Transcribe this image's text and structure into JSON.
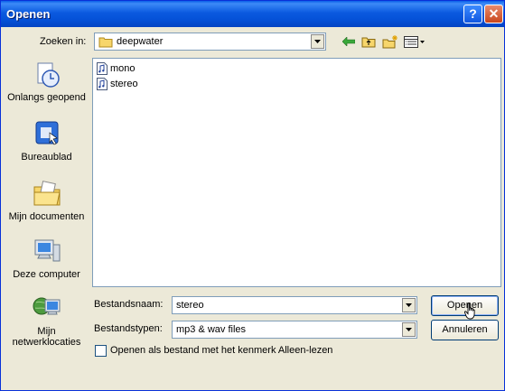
{
  "window": {
    "title": "Openen",
    "help_glyph": "?",
    "close_glyph": "✕"
  },
  "look_in": {
    "label": "Zoeken in:",
    "value": "deepwater"
  },
  "toolbar": {
    "icons": [
      "back-arrow-icon",
      "up-folder-icon",
      "new-folder-icon",
      "view-menu-icon"
    ]
  },
  "places": [
    {
      "label": "Onlangs geopend",
      "icon": "recent-documents-icon"
    },
    {
      "label": "Bureaublad",
      "icon": "desktop-icon"
    },
    {
      "label": "Mijn documenten",
      "icon": "my-documents-icon"
    },
    {
      "label": "Deze computer",
      "icon": "my-computer-icon"
    },
    {
      "label": "Mijn netwerklocaties",
      "icon": "network-places-icon"
    }
  ],
  "files": [
    {
      "name": "mono",
      "icon": "audio-file-icon"
    },
    {
      "name": "stereo",
      "icon": "audio-file-icon"
    }
  ],
  "filename": {
    "label": "Bestandsnaam:",
    "value": "stereo"
  },
  "filetype": {
    "label": "Bestandstypen:",
    "value": "mp3 & wav files"
  },
  "buttons": {
    "open": "Openen",
    "cancel": "Annuleren"
  },
  "readonly_checkbox": {
    "label": "Openen als bestand met het kenmerk Alleen-lezen",
    "checked": false
  },
  "colors": {
    "titlebar": "#0450d6",
    "dialog_bg": "#ece9d8",
    "field_border": "#7f9db9"
  }
}
